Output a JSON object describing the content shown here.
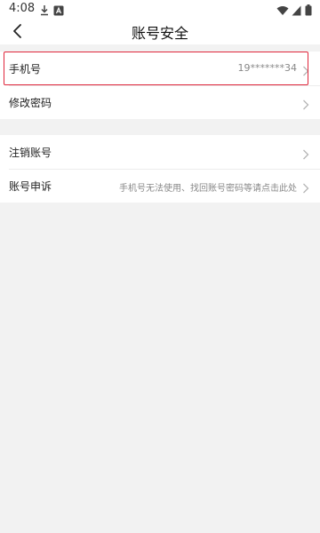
{
  "status_bar": {
    "time": "4:08"
  },
  "header": {
    "title": "账号安全"
  },
  "section1": {
    "phone": {
      "label": "手机号",
      "value": "19*******34"
    },
    "change_password": {
      "label": "修改密码"
    }
  },
  "section2": {
    "cancel_account": {
      "label": "注销账号"
    },
    "appeal": {
      "label": "账号申诉",
      "value": "手机号无法使用、找回账号密码等请点击此处"
    }
  },
  "colors": {
    "highlight": "#e0263b",
    "background": "#f2f2f2",
    "secondary_text": "#888888"
  }
}
